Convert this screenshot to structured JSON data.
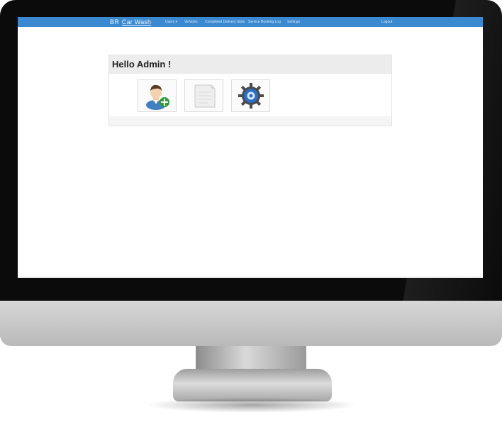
{
  "navbar": {
    "brand_prefix": "BR",
    "brand_name": "Car Wash",
    "items": [
      "Users ▾",
      "Vehicles",
      "Completed Delivery Slots",
      "Service Booking Log",
      "Settings"
    ],
    "logout": "Logout"
  },
  "panel": {
    "greeting": "Hello Admin !"
  },
  "tiles": [
    {
      "icon": "add-user-icon"
    },
    {
      "icon": "document-icon"
    },
    {
      "icon": "settings-gear-icon"
    }
  ],
  "colors": {
    "navbar": "#3b89d0",
    "panel_header": "#ececec"
  }
}
